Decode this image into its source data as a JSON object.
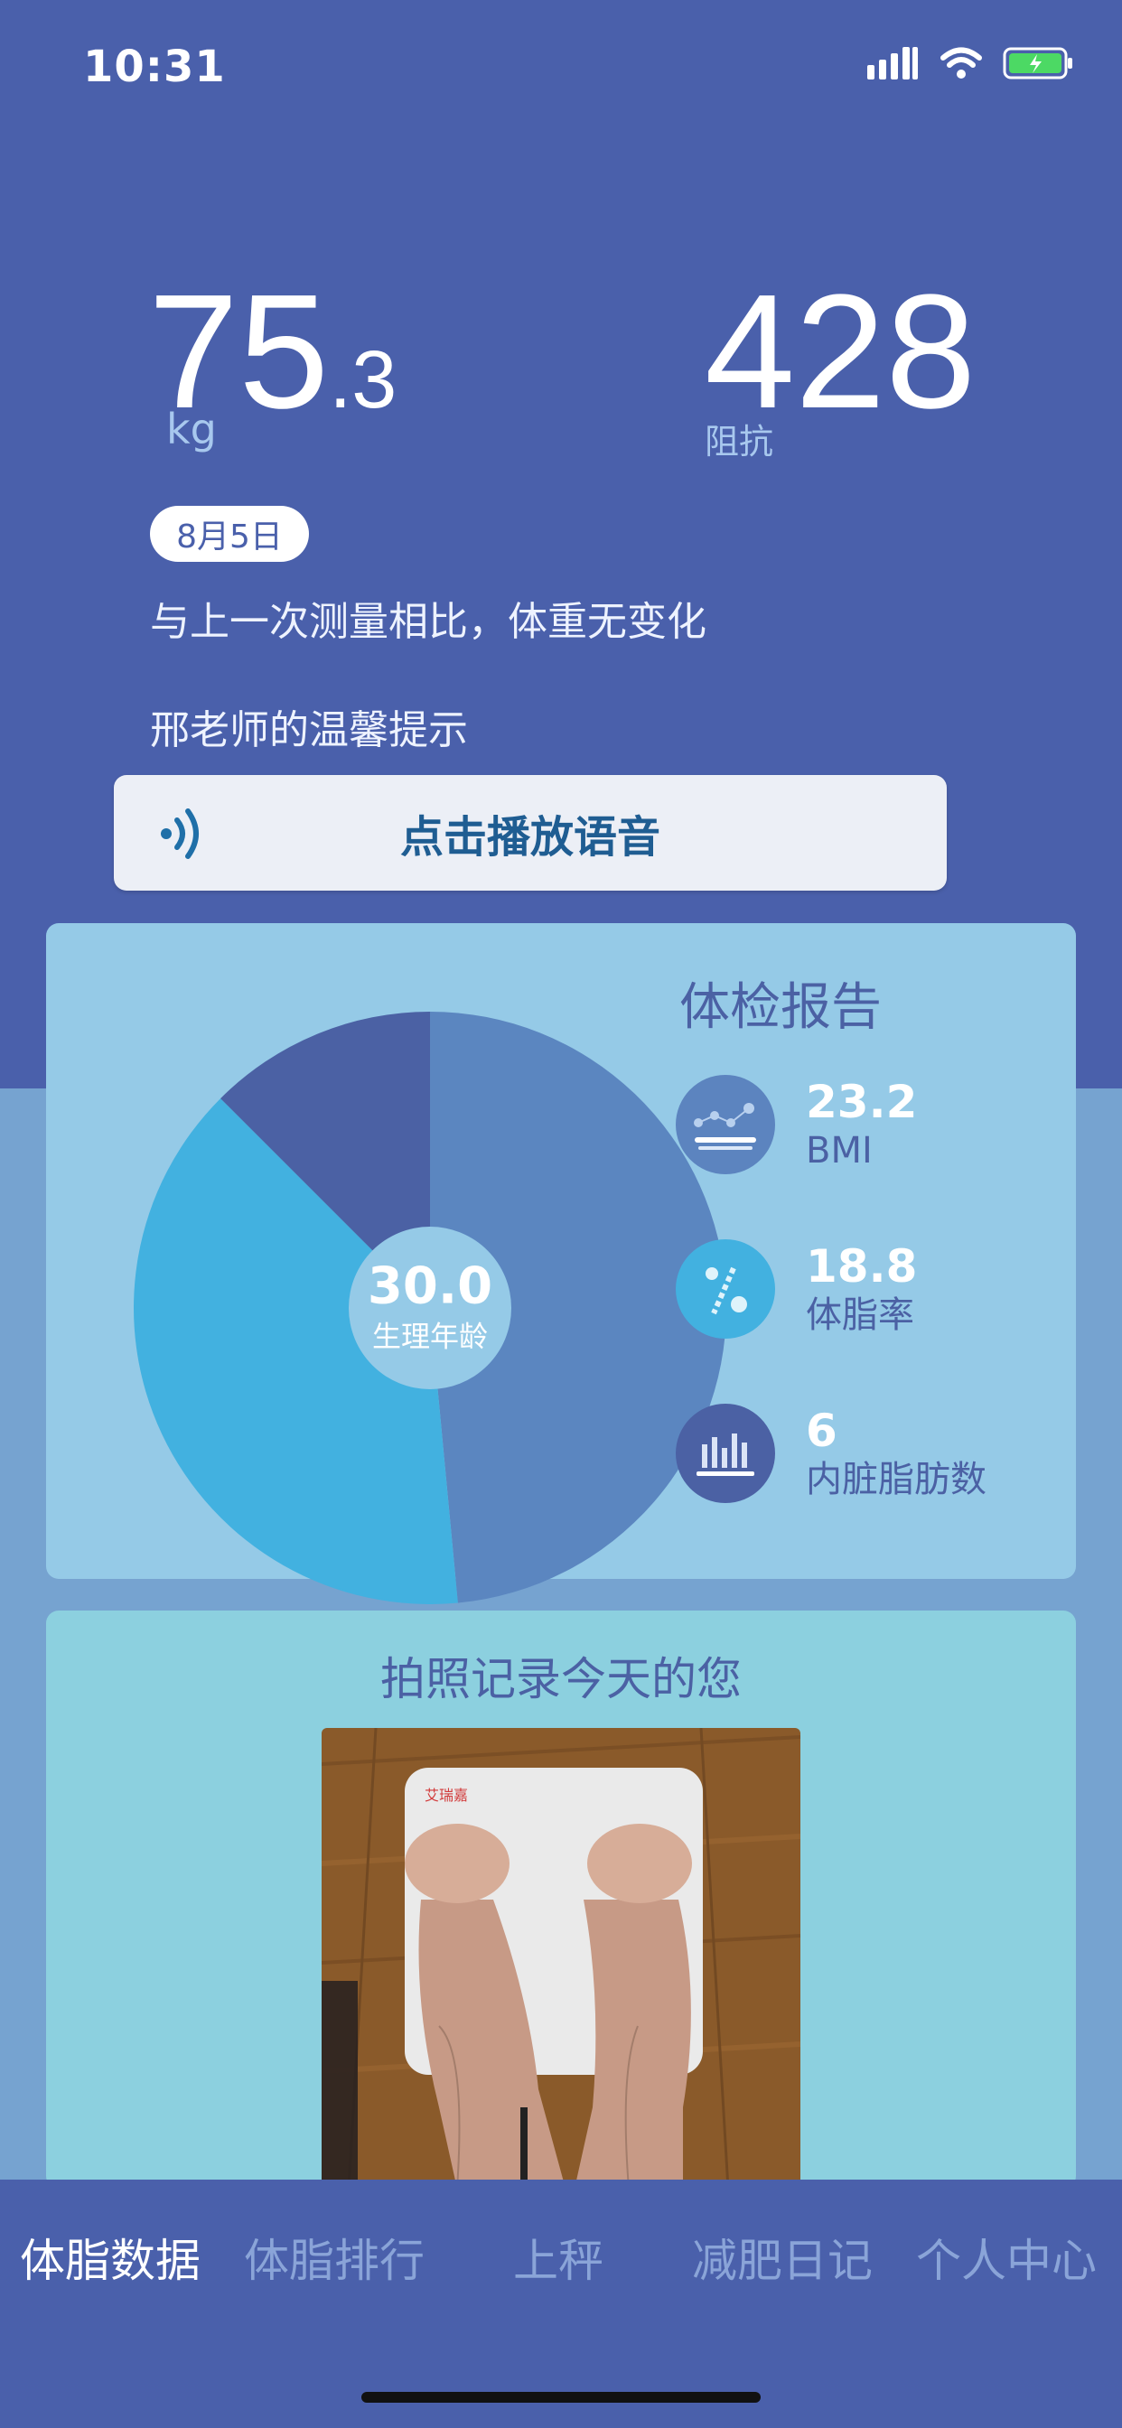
{
  "status_bar": {
    "time": "10:31"
  },
  "measurement": {
    "weight_int": "75",
    "weight_dec": ".3",
    "weight_unit": "kg",
    "impedance": "428",
    "impedance_label": "阻抗",
    "date": "8月5日",
    "comparison": "与上一次测量相比，体重无变化",
    "tip_title": "邢老师的温馨提示"
  },
  "voice_button": {
    "label": "点击播放语音",
    "icon": "voice-waves-icon"
  },
  "report": {
    "title": "体检报告",
    "body_age": "30.0",
    "body_age_label": "生理年龄",
    "stats": [
      {
        "value": "23.2",
        "label": "BMI",
        "icon": "bmi-icon"
      },
      {
        "value": "18.8",
        "label": "体脂率",
        "icon": "body-fat-icon"
      },
      {
        "value": "6",
        "label": "内脏脂肪数",
        "icon": "visceral-fat-icon"
      }
    ]
  },
  "chart_data": {
    "type": "pie",
    "slices": [
      {
        "value": 48.5,
        "color": "#5b86c0"
      },
      {
        "value": 39.0,
        "color": "#42b1e0"
      },
      {
        "value": 12.5,
        "color": "#4b61a4"
      }
    ]
  },
  "photo_section": {
    "title": "拍照记录今天的您",
    "scale_brand": "艾瑞嘉"
  },
  "tabs": [
    {
      "label": "体脂数据",
      "active": true
    },
    {
      "label": "体脂排行",
      "active": false
    },
    {
      "label": "上秤",
      "active": false
    },
    {
      "label": "减肥日记",
      "active": false
    },
    {
      "label": "个人中心",
      "active": false
    }
  ],
  "colors": {
    "header_bg": "#4a60ab",
    "page_bg": "#76a3d0",
    "report_card": "#95cae7",
    "photo_card": "#8cd0df"
  }
}
